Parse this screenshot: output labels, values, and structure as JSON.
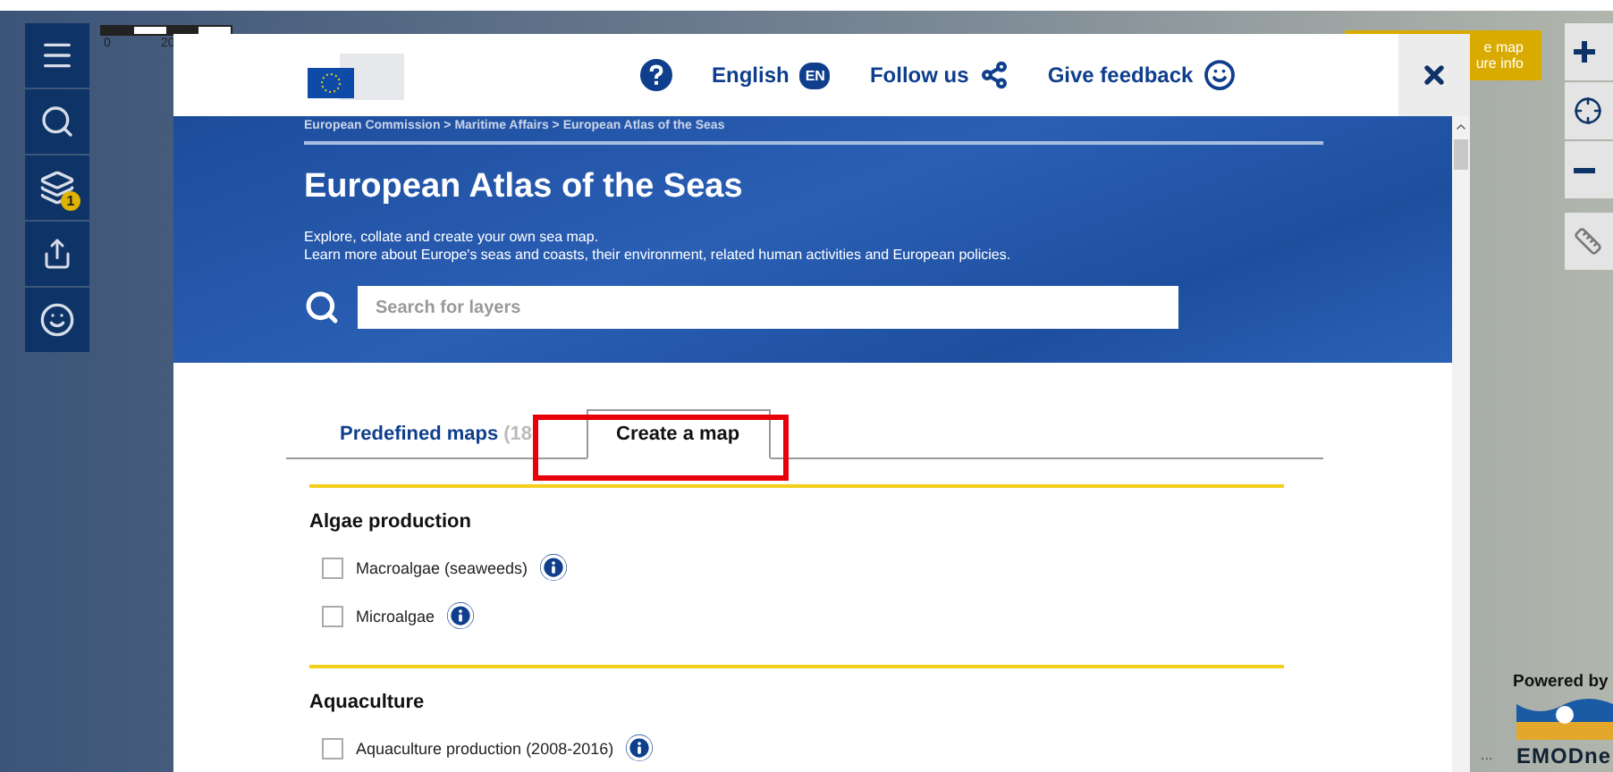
{
  "map": {
    "scale_labels": [
      "0",
      "20"
    ],
    "tooltip_lines": [
      "e map",
      "ure info"
    ],
    "powered_by": "Powered by",
    "logo_text": "EMODne",
    "attribution": "..."
  },
  "toolbar": {
    "layers_badge": "1"
  },
  "modal": {
    "header": {
      "language": "English",
      "language_code": "EN",
      "follow": "Follow us",
      "feedback": "Give feedback"
    },
    "breadcrumb": "European Commission > Maritime Affairs > European Atlas of the Seas",
    "title": "European Atlas of the Seas",
    "description": [
      "Explore, collate and create your own sea map.",
      "Learn more about Europe's seas and coasts, their environment, related human activities and European policies."
    ],
    "search": {
      "placeholder": "Search for layers"
    },
    "tabs": [
      {
        "label": "Predefined maps",
        "count": "(18",
        "selected": false
      },
      {
        "label": "Create a map",
        "selected": true
      }
    ],
    "sections": [
      {
        "title": "Algae production",
        "layers": [
          {
            "label": "Macroalgae (seaweeds)",
            "checked": false
          },
          {
            "label": "Microalgae",
            "checked": false
          }
        ]
      },
      {
        "title": "Aquaculture",
        "layers": [
          {
            "label": "Aquaculture production (2008-2016)",
            "checked": false
          }
        ]
      }
    ]
  }
}
